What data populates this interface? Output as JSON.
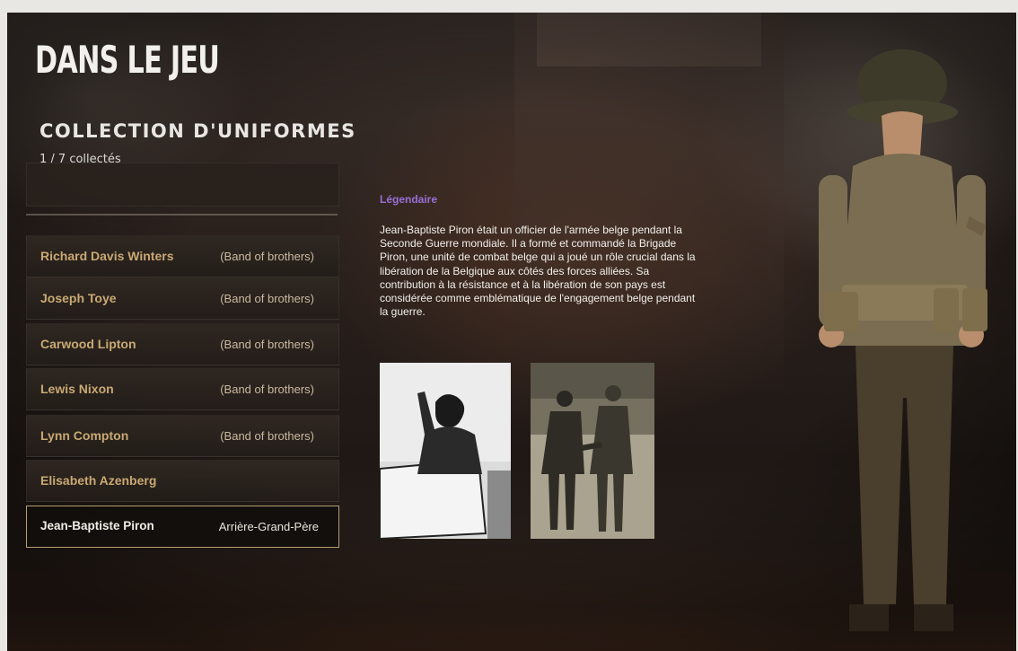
{
  "header": {
    "title": "DANS LE JEU",
    "subtitle": "COLLECTION D'UNIFORMES",
    "counter": "1 / 7 collectés"
  },
  "uniforms": [
    {
      "name": "Richard Davis Winters",
      "tag": "(Band of brothers)"
    },
    {
      "name": "Joseph Toye",
      "tag": "(Band of brothers)"
    },
    {
      "name": "Carwood Lipton",
      "tag": "(Band of brothers)"
    },
    {
      "name": "Lewis Nixon",
      "tag": "(Band of brothers)"
    },
    {
      "name": "Lynn Compton",
      "tag": "(Band of brothers)"
    },
    {
      "name": "Elisabeth Azenberg",
      "tag": ""
    },
    {
      "name": "Jean-Baptiste Piron",
      "tag": "Arrière-Grand-Père",
      "selected": true
    }
  ],
  "detail": {
    "rarity": "Légendaire",
    "description": "Jean-Baptiste Piron était un officier de l'armée belge pendant la Seconde Guerre mondiale. Il a formé et commandé la Brigade Piron, une unité de combat belge qui a joué un rôle crucial dans la libération de la Belgique aux côtés des forces alliées. Sa contribution à la résistance et à la libération de son pays est considérée comme emblématique de l'engagement belge pendant la guerre."
  },
  "colors": {
    "accent_gold": "#c9a973",
    "rarity_purple": "#9b6fd8",
    "selected_border": "#b79e6f"
  }
}
